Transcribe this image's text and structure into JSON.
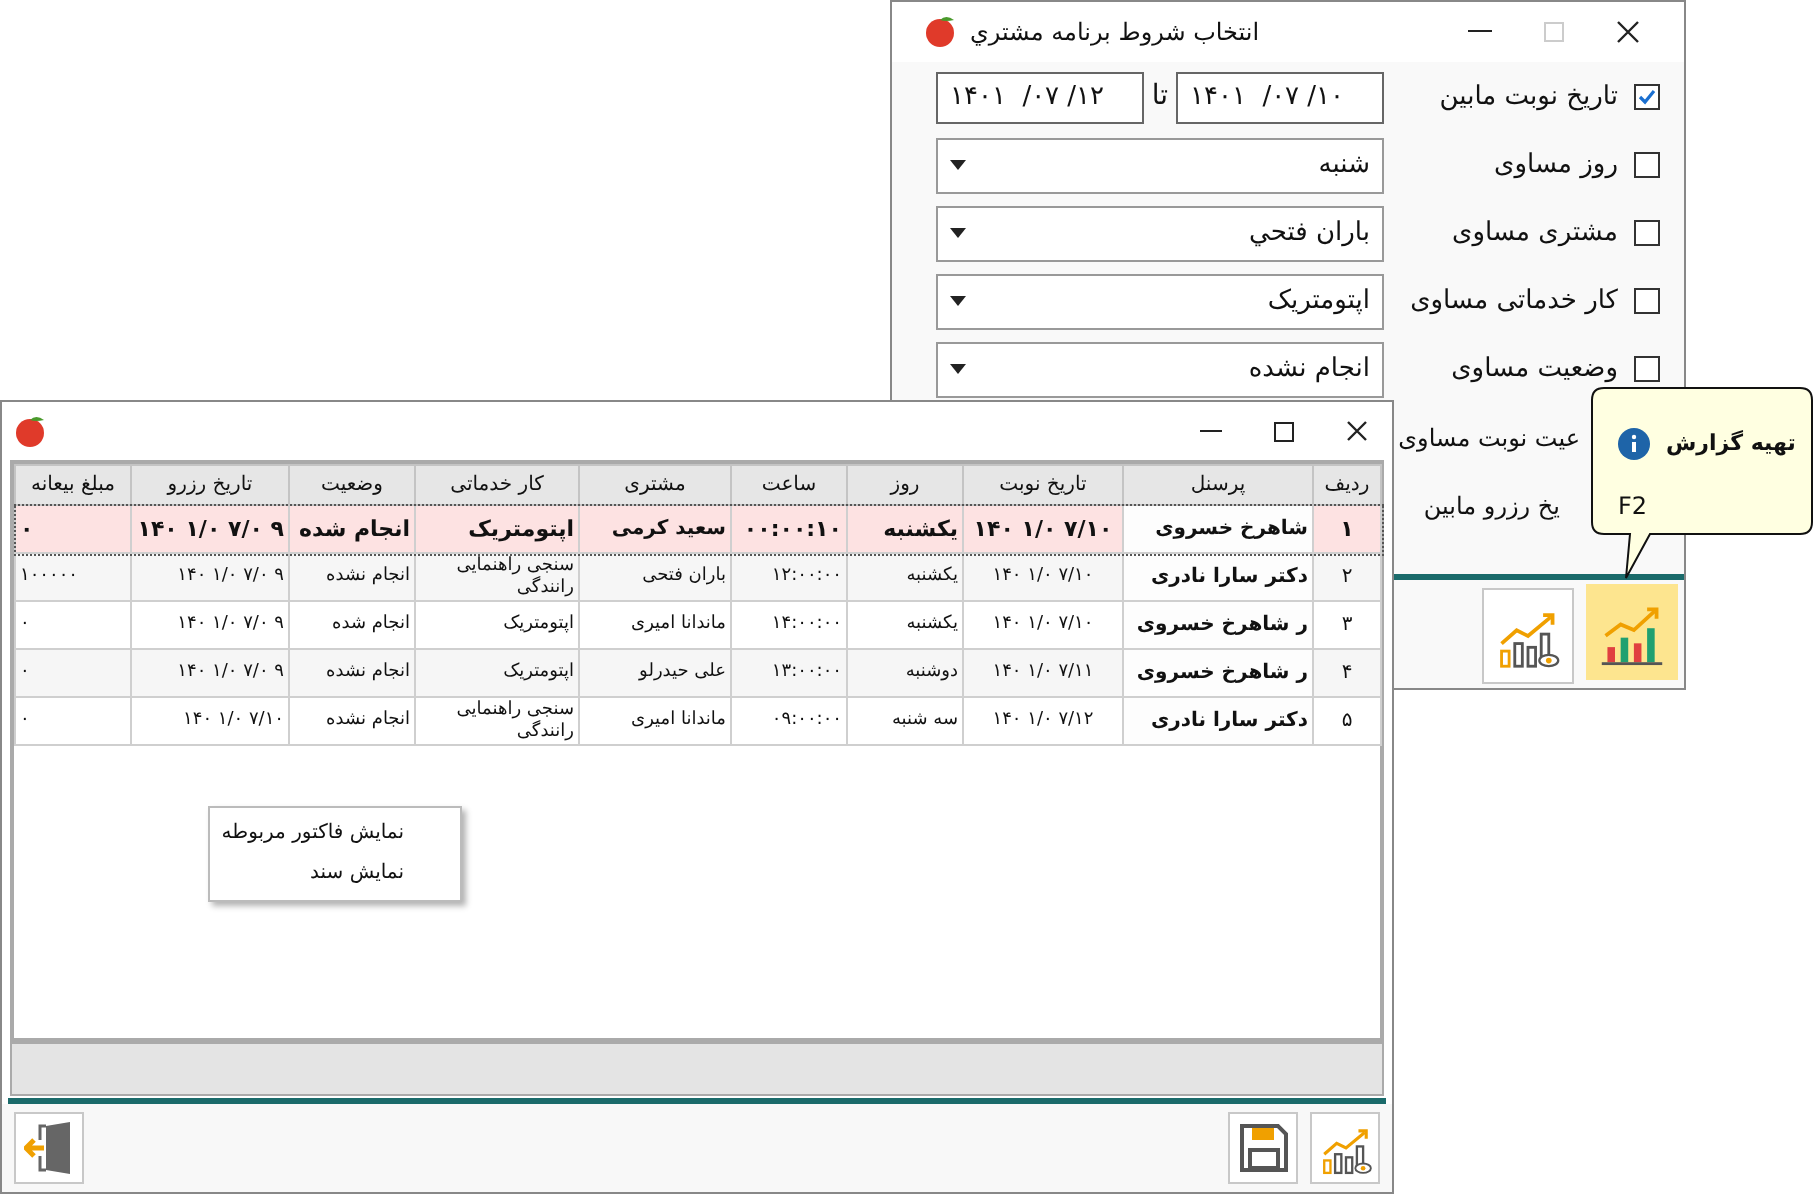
{
  "dialog": {
    "title": "انتخاب شروط برنامه مشتري",
    "conditions": [
      {
        "kind": "date_range",
        "label": "تاریخ نوبت مابین",
        "checked": true,
        "from": "۱۴۰۱  /۰۷ /۱۰",
        "to_label": "تا",
        "to": "۱۴۰۱  /۰۷ /۱۲"
      },
      {
        "kind": "combo",
        "label": "روز مساوی",
        "checked": false,
        "value": "شنبه"
      },
      {
        "kind": "combo",
        "label": "مشتری مساوی",
        "checked": false,
        "value": "باران فتحي"
      },
      {
        "kind": "combo",
        "label": "کار خدماتی مساوی",
        "checked": false,
        "value": "اپتومتریک"
      },
      {
        "kind": "combo",
        "label": "وضعیت مساوی",
        "checked": false,
        "value": "انجام نشده"
      },
      {
        "kind": "partial",
        "label": "عیت نوبت مساوی"
      },
      {
        "kind": "partial",
        "label": "یخ رزرو مابین"
      }
    ],
    "buttons": [
      {
        "kind": "report_preview",
        "selected": false
      },
      {
        "kind": "report",
        "selected": true
      }
    ]
  },
  "tooltip": {
    "title": "تهیه گزارش",
    "shortcut": "F2"
  },
  "main_window": {
    "table": {
      "columns": [
        "ردیف",
        "پرسنل",
        "تاریخ نوبت",
        "روز",
        "ساعت",
        "مشتری",
        "کار خدماتی",
        "وضعیت",
        "تاریخ رزرو",
        "مبلغ بیعانه"
      ],
      "rows": [
        {
          "selected": true,
          "cells": [
            "۱",
            "شاهرخ خسروی",
            "۱۴۰ ۱/۰ ۷/۱۰",
            "یکشنبه",
            "۰۰:۰۰:۱۰",
            "سعید کرمی",
            "اپتومتریک",
            "انجام شده",
            "۱۴۰ ۱/۰ ۷/۰ ۹",
            "۰"
          ]
        },
        {
          "selected": false,
          "cells": [
            "۲",
            "دکتر سارا نادری",
            "۱۴۰ ۱/۰ ۷/۱۰",
            "یکشنبه",
            "۱۲:۰۰:۰۰",
            "باران فتحی",
            "سنجی راهنمایی رانندگی",
            "انجام نشده",
            "۱۴۰ ۱/۰ ۷/۰ ۹",
            "۱۰۰۰۰۰"
          ]
        },
        {
          "selected": false,
          "cells": [
            "۳",
            "ر شاهرخ خسروی",
            "۱۴۰ ۱/۰ ۷/۱۰",
            "یکشنبه",
            "۱۴:۰۰:۰۰",
            "ماندانا امیری",
            "اپتومتریک",
            "انجام شده",
            "۱۴۰ ۱/۰ ۷/۰ ۹",
            "۰"
          ]
        },
        {
          "selected": false,
          "cells": [
            "۴",
            "ر شاهرخ خسروی",
            "۱۴۰ ۱/۰ ۷/۱۱",
            "دوشنبه",
            "۱۳:۰۰:۰۰",
            "علی حیدرلو",
            "اپتومتریک",
            "انجام نشده",
            "۱۴۰ ۱/۰ ۷/۰ ۹",
            "۰"
          ]
        },
        {
          "selected": false,
          "cells": [
            "۵",
            "دکتر سارا نادری",
            "۱۴۰ ۱/۰ ۷/۱۲",
            "سه شنبه",
            "۰۹:۰۰:۰۰",
            "ماندانا امیری",
            "سنجی راهنمایی رانندگی",
            "انجام نشده",
            "۱۴۰ ۱/۰ ۷/۱۰",
            "۰"
          ]
        }
      ]
    },
    "context_menu": [
      "نمایش فاکتور مربوطه",
      "نمایش سند"
    ],
    "footer_buttons": [
      {
        "kind": "exit"
      },
      {
        "kind": "save"
      },
      {
        "kind": "report_preview"
      }
    ]
  }
}
